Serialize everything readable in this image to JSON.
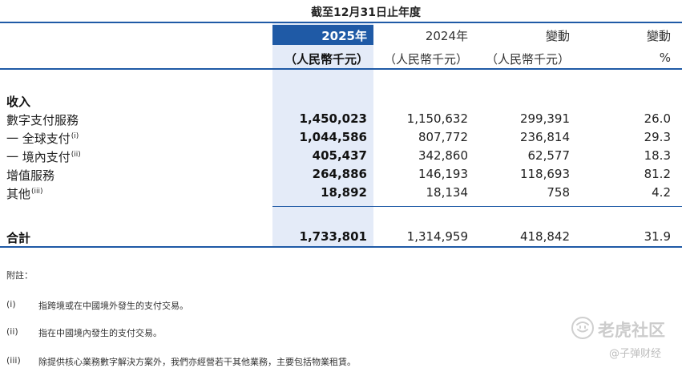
{
  "header": {
    "period": "截至12月31日止年度",
    "columns": [
      {
        "label": "2025年",
        "unit": "（人民幣千元）"
      },
      {
        "label": "2024年",
        "unit": "（人民幣千元）"
      },
      {
        "label": "變動",
        "unit": "（人民幣千元）"
      },
      {
        "label": "變動",
        "unit": "%"
      }
    ]
  },
  "section_title": "收入",
  "rows": [
    {
      "label": "數字支付服務",
      "sup": "",
      "v2025": "1,450,023",
      "v2024": "1,150,632",
      "change": "299,391",
      "pct": "26.0"
    },
    {
      "label": "一 全球支付",
      "sup": "(i)",
      "v2025": "1,044,586",
      "v2024": "807,772",
      "change": "236,814",
      "pct": "29.3"
    },
    {
      "label": "一 境內支付",
      "sup": "(ii)",
      "v2025": "405,437",
      "v2024": "342,860",
      "change": "62,577",
      "pct": "18.3"
    },
    {
      "label": "增值服務",
      "sup": "",
      "v2025": "264,886",
      "v2024": "146,193",
      "change": "118,693",
      "pct": "81.2"
    },
    {
      "label": "其他",
      "sup": "(iii)",
      "v2025": "18,892",
      "v2024": "18,134",
      "change": "758",
      "pct": "4.2"
    }
  ],
  "total": {
    "label": "合計",
    "v2025": "1,733,801",
    "v2024": "1,314,959",
    "change": "418,842",
    "pct": "31.9"
  },
  "notes": {
    "title": "附註：",
    "items": [
      {
        "marker": "(i)",
        "text": "指跨境或在中國境外發生的支付交易。"
      },
      {
        "marker": "(ii)",
        "text": "指在中國境內發生的支付交易。"
      },
      {
        "marker": "(iii)",
        "text": "除提供核心業務數字解決方案外，我們亦經營若干其他業務，主要包括物業租賃。"
      }
    ]
  },
  "watermark": {
    "brand": "老虎社区",
    "author": "@子弹财经",
    "icon": "tiger-logo-icon"
  },
  "colors": {
    "accent": "#1f5aa6",
    "highlight": "#e4ebf8"
  }
}
